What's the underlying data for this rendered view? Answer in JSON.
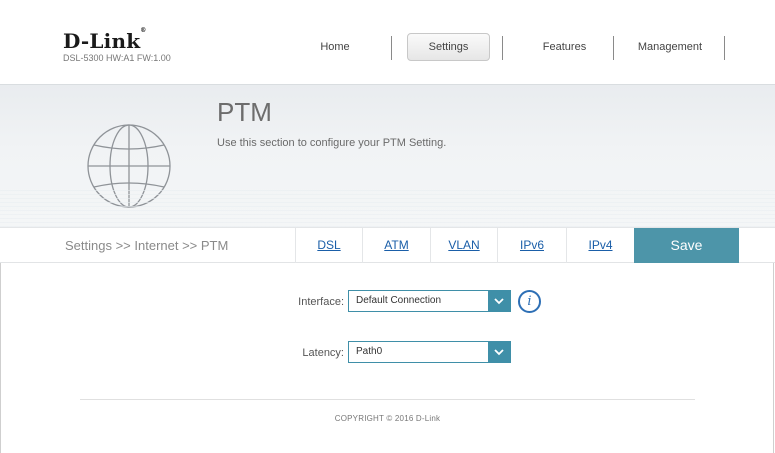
{
  "header": {
    "brand": "D-Link",
    "model": "DSL-5300 HW:A1 FW:1.00"
  },
  "nav": {
    "items": [
      {
        "label": "Home",
        "active": false
      },
      {
        "label": "Settings",
        "active": true
      },
      {
        "label": "Features",
        "active": false
      },
      {
        "label": "Management",
        "active": false
      }
    ]
  },
  "banner": {
    "icon": "globe-icon",
    "title": "PTM",
    "description": "Use this section to configure your PTM Setting."
  },
  "tabbar": {
    "breadcrumb": "Settings >> Internet >> PTM",
    "tabs": [
      "DSL",
      "ATM",
      "VLAN",
      "IPv6",
      "IPv4"
    ],
    "save_label": "Save"
  },
  "form": {
    "interface": {
      "label": "Interface:",
      "value": "Default Connection"
    },
    "latency": {
      "label": "Latency:",
      "value": "Path0"
    }
  },
  "footer": {
    "copyright": "COPYRIGHT © 2016 D-Link"
  },
  "colors": {
    "accent": "#4d95a9",
    "select_border": "#3f8fa8",
    "link": "#1a5ea8",
    "info": "#2d6fb5"
  }
}
